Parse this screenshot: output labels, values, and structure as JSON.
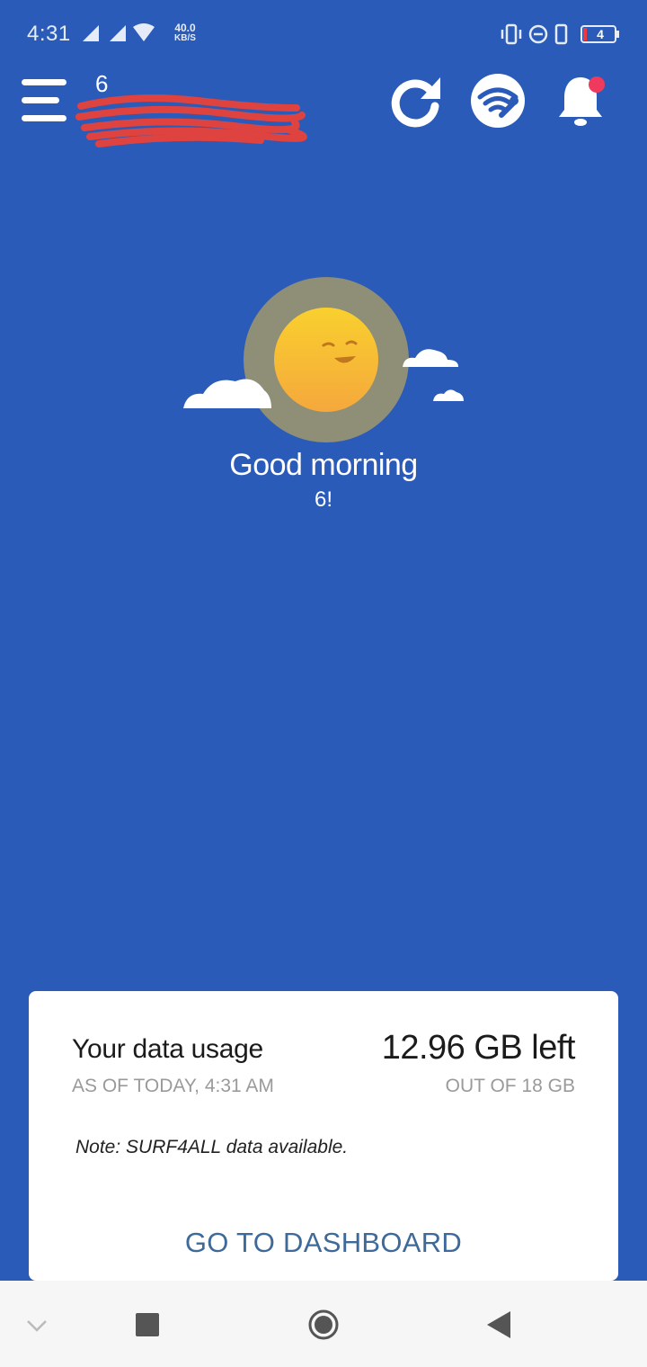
{
  "status_bar": {
    "time": "4:31",
    "net_speed_value": "40.0",
    "net_speed_unit": "KB/S",
    "battery_level": "4",
    "icons": [
      "signal-icon",
      "signal-icon",
      "wifi-icon",
      "vibrate-icon",
      "do-not-disturb-icon",
      "phone-icon",
      "battery-icon"
    ]
  },
  "header": {
    "user_number": "6",
    "icons": [
      "menu-icon",
      "refresh-icon",
      "wifi-wrench-icon",
      "bell-icon"
    ]
  },
  "greeting": {
    "text": "Good morning",
    "name": "6!"
  },
  "data_card": {
    "title": "Your data usage",
    "as_of": "AS OF TODAY, 4:31 AM",
    "remaining": "12.96 GB left",
    "total": "OUT OF 18 GB",
    "note": "Note: SURF4ALL data available.",
    "dashboard_button": "GO TO DASHBOARD"
  },
  "nav_bar": {
    "icons": [
      "chevron-down-icon",
      "recents-icon",
      "home-icon",
      "back-icon"
    ]
  },
  "colors": {
    "background": "#2a5bb8",
    "card": "#ffffff",
    "link": "#3e6a9a",
    "notification_dot": "#ef3a5d",
    "sun": "#f7c531"
  }
}
